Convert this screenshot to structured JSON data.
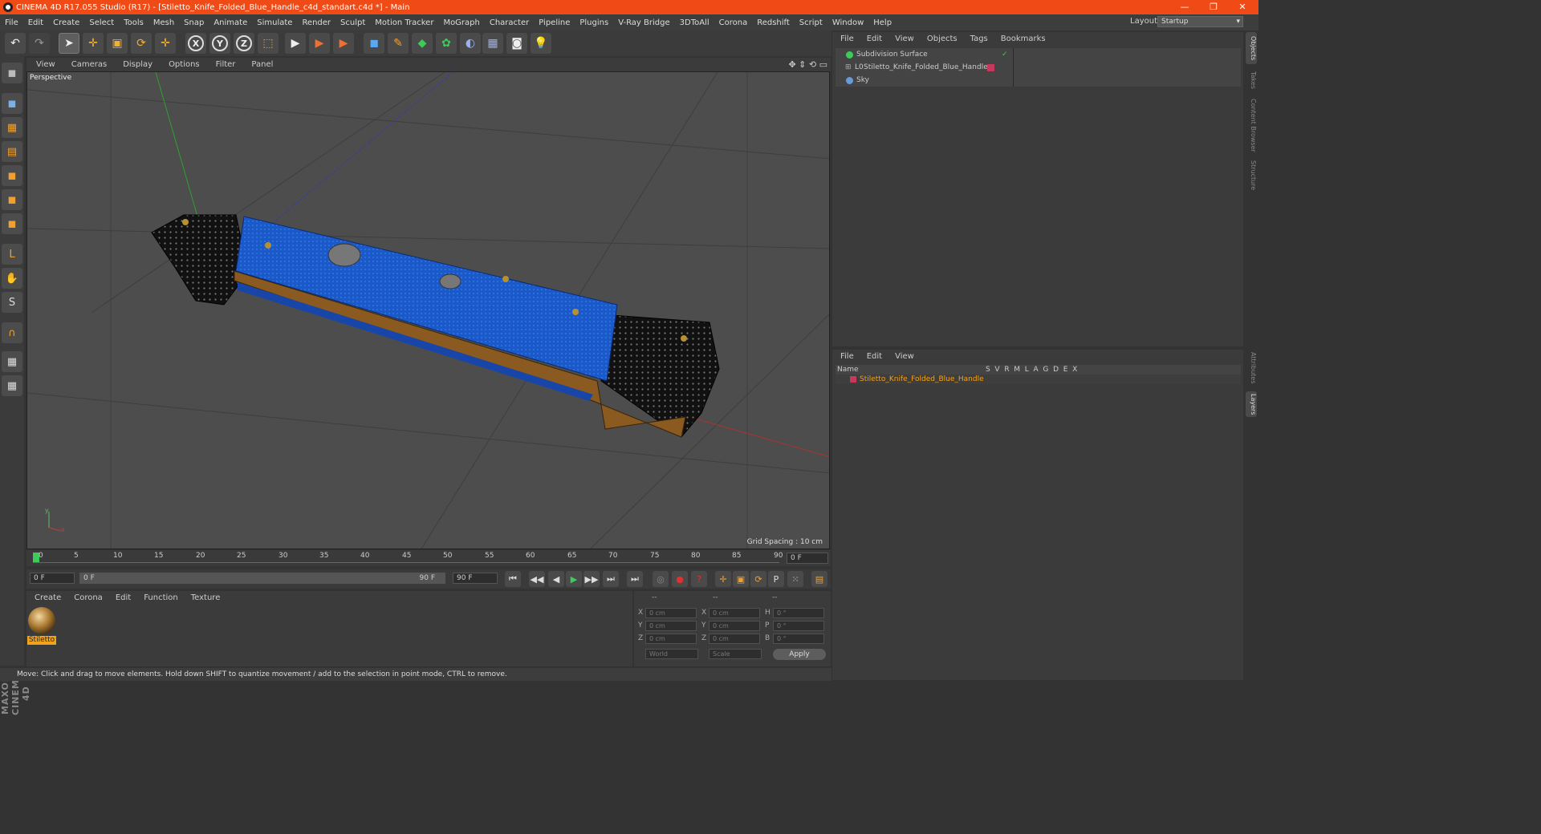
{
  "window": {
    "title": "CINEMA 4D R17.055 Studio (R17) - [Stiletto_Knife_Folded_Blue_Handle_c4d_standart.c4d *] - Main",
    "min": "—",
    "restore": "❐",
    "close": "✕"
  },
  "menu": [
    "File",
    "Edit",
    "Create",
    "Select",
    "Tools",
    "Mesh",
    "Snap",
    "Animate",
    "Simulate",
    "Render",
    "Sculpt",
    "Motion Tracker",
    "MoGraph",
    "Character",
    "Pipeline",
    "Plugins",
    "V-Ray Bridge",
    "3DToAll",
    "Corona",
    "Redshift",
    "Script",
    "Window",
    "Help"
  ],
  "layout": {
    "label": "Layout:",
    "value": "Startup"
  },
  "toolbar": {
    "undo": "↶",
    "redo": "↷",
    "select": "➤",
    "move": "✛",
    "scale": "▣",
    "rotate": "⟳",
    "move2": "✛",
    "x": "X",
    "y": "Y",
    "z": "Z",
    "coord": "⬚",
    "render_view": "▶",
    "render_pic": "▶",
    "render_settings": "▶",
    "cube": "◼",
    "pen": "✎",
    "subdiv": "◆",
    "array": "✿",
    "deformer": "◐",
    "floor": "▦",
    "camera": "◙",
    "light": "💡"
  },
  "left_tools": [
    "◼",
    "▦",
    "▤",
    "◼",
    "◼",
    "◼",
    "L",
    "✋",
    "S",
    "∩",
    "▦",
    "▦"
  ],
  "viewport": {
    "menu": [
      "View",
      "Cameras",
      "Display",
      "Options",
      "Filter",
      "Panel"
    ],
    "label": "Perspective",
    "grid_spacing": "Grid Spacing : 10 cm",
    "nav_icons": "✥ ⇕ ⟲ ▭",
    "axis_y": "y",
    "axis_x": "x"
  },
  "timeline": {
    "ticks": [
      "0",
      "5",
      "10",
      "15",
      "20",
      "25",
      "30",
      "35",
      "40",
      "45",
      "50",
      "55",
      "60",
      "65",
      "70",
      "75",
      "80",
      "85",
      "90"
    ],
    "frame_field": "0 F"
  },
  "transport": {
    "start": "0 F",
    "range_start": "0 F",
    "range_end": "90 F",
    "end": "90 F",
    "buttons": [
      "⏮",
      "◀◀",
      "◀",
      "▶",
      "▶▶",
      "⏭",
      "⏭"
    ],
    "rec": [
      "◎",
      "●",
      "?"
    ],
    "modes": [
      "✛",
      "▣",
      "⟳",
      "P",
      "⁙",
      "▤"
    ]
  },
  "material_panel": {
    "menu": [
      "Create",
      "Corona",
      "Edit",
      "Function",
      "Texture"
    ],
    "material": "Stiletto"
  },
  "coords": {
    "headers": [
      "--",
      "--",
      "--"
    ],
    "rows": [
      {
        "l1": "X",
        "v1": "0 cm",
        "l2": "X",
        "v2": "0 cm",
        "l3": "H",
        "v3": "0 °"
      },
      {
        "l1": "Y",
        "v1": "0 cm",
        "l2": "Y",
        "v2": "0 cm",
        "l3": "P",
        "v3": "0 °"
      },
      {
        "l1": "Z",
        "v1": "0 cm",
        "l2": "Z",
        "v2": "0 cm",
        "l3": "B",
        "v3": "0 °"
      }
    ],
    "world": "World",
    "scale": "Scale",
    "apply": "Apply"
  },
  "status": "Move: Click and drag to move elements. Hold down SHIFT to quantize movement / add to the selection in point mode, CTRL to remove.",
  "object_manager": {
    "menu": [
      "File",
      "Edit",
      "View",
      "Objects",
      "Tags",
      "Bookmarks"
    ],
    "objects": [
      {
        "name": "Subdivision Surface",
        "check": "✓"
      },
      {
        "name": "Stiletto_Knife_Folded_Blue_Handle",
        "check": ""
      },
      {
        "name": "Sky",
        "check": ""
      }
    ]
  },
  "layer_manager": {
    "menu": [
      "File",
      "Edit",
      "View"
    ],
    "header": {
      "name": "Name",
      "cols": "S  V  R  M  L  A  G  D  E  X"
    },
    "layer": "Stiletto_Knife_Folded_Blue_Handle"
  },
  "right_tabs": [
    "Objects",
    "Takes",
    "Content Browser",
    "Structure",
    "Attributes",
    "Layers"
  ],
  "branding": "MAXON CINEMA 4D",
  "colors": {
    "title_bar": "#f04b16",
    "accent_orange": "#f2a31a",
    "handle_blue": "#1b58c8",
    "layer_red": "#c8385a"
  }
}
